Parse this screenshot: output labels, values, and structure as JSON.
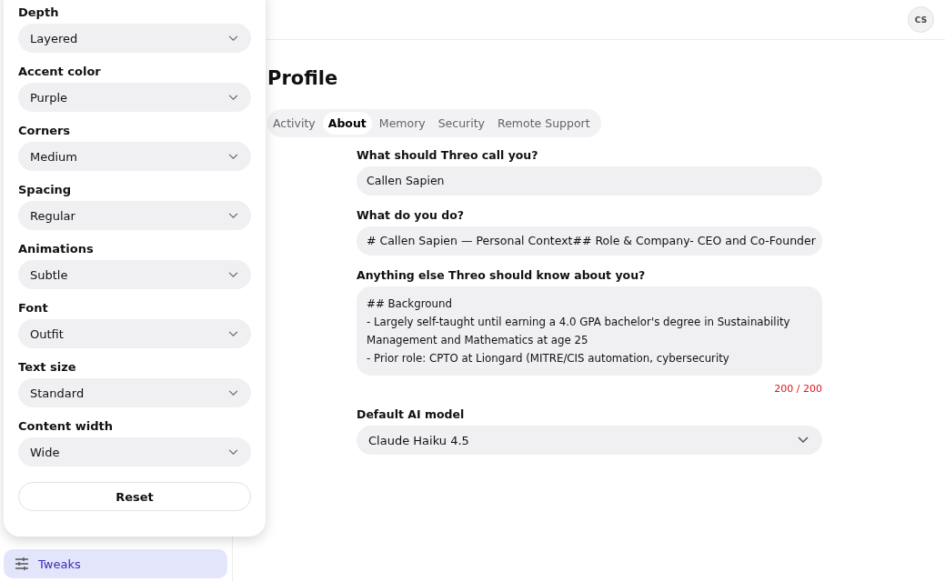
{
  "tweaks_panel": {
    "settings": [
      {
        "label": "Depth",
        "value": "Layered"
      },
      {
        "label": "Accent color",
        "value": "Purple"
      },
      {
        "label": "Corners",
        "value": "Medium"
      },
      {
        "label": "Spacing",
        "value": "Regular"
      },
      {
        "label": "Animations",
        "value": "Subtle"
      },
      {
        "label": "Font",
        "value": "Outfit"
      },
      {
        "label": "Text size",
        "value": "Standard"
      },
      {
        "label": "Content width",
        "value": "Wide"
      }
    ],
    "reset_button": "Reset"
  },
  "sidebar": {
    "items": [
      {
        "label": "Tweaks",
        "selected": true
      }
    ]
  },
  "header": {
    "avatar": "CS"
  },
  "page": {
    "title": "Profile",
    "tabs": [
      {
        "label": "Activity",
        "selected": false
      },
      {
        "label": "About",
        "selected": true
      },
      {
        "label": "Memory",
        "selected": false
      },
      {
        "label": "Security",
        "selected": false
      },
      {
        "label": "Remote Support",
        "selected": false
      }
    ],
    "fields": [
      {
        "kind": "input",
        "label": "What should Threo call you?",
        "value": "Callen Sapien"
      },
      {
        "kind": "input",
        "label": "What do you do?",
        "value": "# Callen Sapien — Personal Context## Role & Company- CEO and Co-Founder"
      },
      {
        "kind": "textarea",
        "label": "Anything else Threo should know about you?",
        "lines": [
          "## Background",
          "- Largely self-taught until earning a 4.0 GPA bachelor's degree in Sustainability Management and Mathematics at age 25",
          "- Prior role: CPTO at Liongard (MITRE/CIS automation, cybersecurity"
        ],
        "counter": "200 / 200",
        "over_limit": true
      },
      {
        "kind": "select",
        "label": "Default AI model",
        "value": "Claude Haiku 4.5"
      }
    ]
  }
}
